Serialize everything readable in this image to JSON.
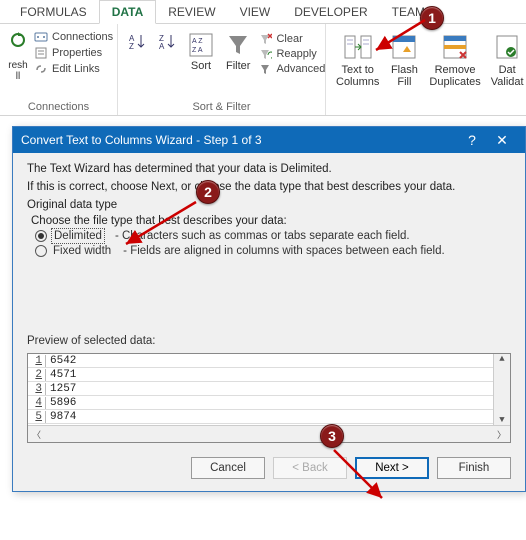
{
  "ribbon": {
    "tabs": [
      "FORMULAS",
      "DATA",
      "REVIEW",
      "VIEW",
      "DEVELOPER",
      "TEAM"
    ],
    "active_tab": "DATA",
    "connections": {
      "items": [
        "Connections",
        "Properties",
        "Edit Links"
      ],
      "refresh_label": "resh\nll",
      "label": "Connections"
    },
    "sort_filter": {
      "sort_label": "Sort",
      "filter_label": "Filter",
      "clear": "Clear",
      "reapply": "Reapply",
      "advanced": "Advanced",
      "label": "Sort & Filter"
    },
    "data_tools": {
      "text_to_columns": "Text to\nColumns",
      "flash_fill": "Flash\nFill",
      "remove_duplicates": "Remove\nDuplicates",
      "data_validation": "Dat\nValidat"
    }
  },
  "dialog": {
    "title": "Convert Text to Columns Wizard - Step 1 of 3",
    "line1": "The Text Wizard has determined that your data is Delimited.",
    "line2": "If this is correct, choose Next, or choose the data type that best describes your data.",
    "group_label": "Original data type",
    "choose_label": "Choose the file type that best describes your data:",
    "delimited_label": "Delimited",
    "delimited_desc": "- Characters such as commas or tabs separate each field.",
    "fixed_label": "Fixed width",
    "fixed_desc": "- Fields are aligned in columns with spaces between each field.",
    "preview_label": "Preview of selected data:",
    "preview_rows": [
      {
        "n": "1",
        "v": "6542"
      },
      {
        "n": "2",
        "v": "4571"
      },
      {
        "n": "3",
        "v": "1257"
      },
      {
        "n": "4",
        "v": "5896"
      },
      {
        "n": "5",
        "v": "9874"
      }
    ],
    "buttons": {
      "cancel": "Cancel",
      "back": "< Back",
      "next": "Next >",
      "finish": "Finish"
    }
  },
  "callouts": {
    "c1": "1",
    "c2": "2",
    "c3": "3"
  }
}
